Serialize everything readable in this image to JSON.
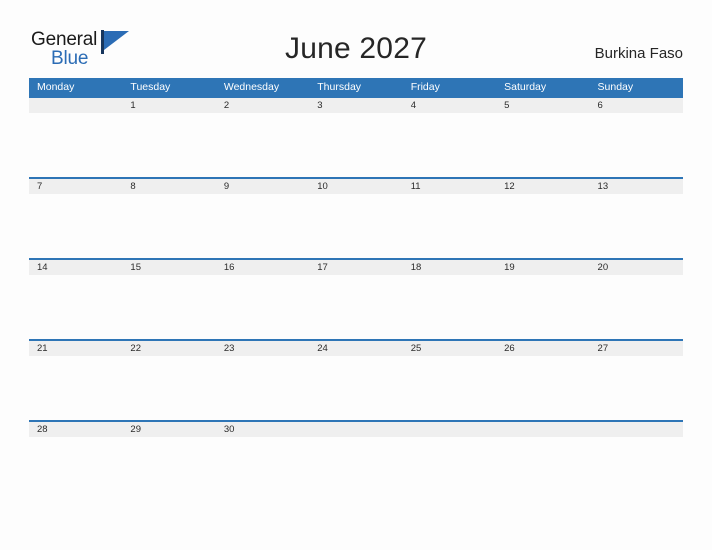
{
  "logo": {
    "word_top": "General",
    "word_bottom": "Blue",
    "flag_icon": "flag-triangle-icon",
    "color_dark": "#1a1a1a",
    "color_blue": "#2b6cb5"
  },
  "header": {
    "title": "June 2027",
    "country": "Burkina Faso"
  },
  "colors": {
    "header_bar": "#2e75b6",
    "date_band": "#efefef",
    "page_background": "#fdfdfd",
    "text": "#262626"
  },
  "calendar": {
    "month": "June",
    "year": "2027",
    "weekdays": [
      "Monday",
      "Tuesday",
      "Wednesday",
      "Thursday",
      "Friday",
      "Saturday",
      "Sunday"
    ],
    "weeks": [
      [
        "",
        "1",
        "2",
        "3",
        "4",
        "5",
        "6"
      ],
      [
        "7",
        "8",
        "9",
        "10",
        "11",
        "12",
        "13"
      ],
      [
        "14",
        "15",
        "16",
        "17",
        "18",
        "19",
        "20"
      ],
      [
        "21",
        "22",
        "23",
        "24",
        "25",
        "26",
        "27"
      ],
      [
        "28",
        "29",
        "30",
        "",
        "",
        "",
        ""
      ]
    ]
  }
}
